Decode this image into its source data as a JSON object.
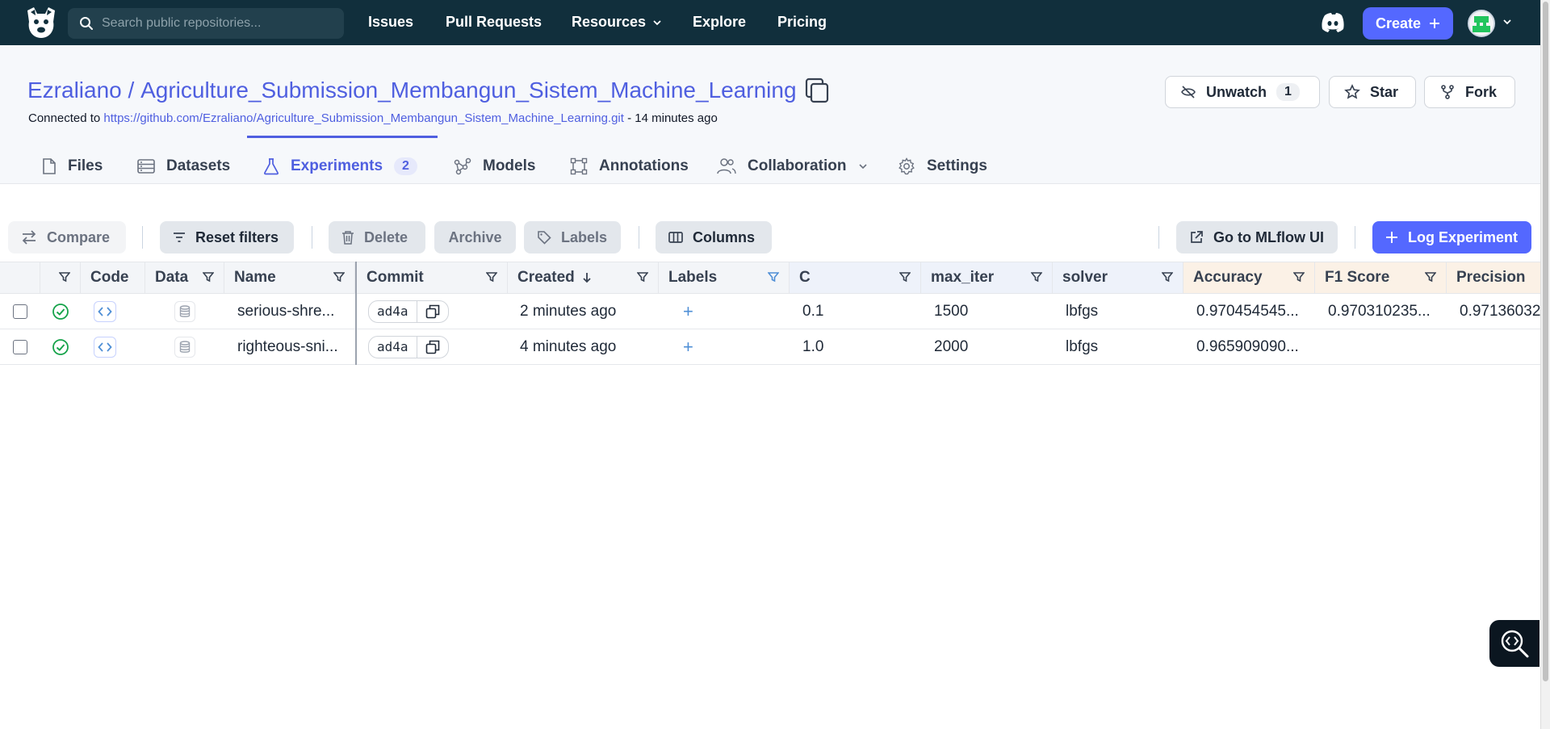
{
  "nav": {
    "search_placeholder": "Search public repositories...",
    "links": [
      "Issues",
      "Pull Requests",
      "Resources",
      "Explore",
      "Pricing"
    ],
    "create_label": "Create"
  },
  "repo": {
    "owner": "Ezraliano",
    "separator": " / ",
    "name": "Agriculture_Submission_Membangun_Sistem_Machine_Learning",
    "connected_prefix": "Connected to ",
    "connected_url": "https://github.com/Ezraliano/Agriculture_Submission_Membangun_Sistem_Machine_Learning.git",
    "connected_suffix": " - 14 minutes ago",
    "unwatch_label": "Unwatch",
    "unwatch_count": "1",
    "star_label": "Star",
    "fork_label": "Fork"
  },
  "tabs": {
    "files": "Files",
    "datasets": "Datasets",
    "experiments": "Experiments",
    "experiments_count": "2",
    "models": "Models",
    "annotations": "Annotations",
    "collaboration": "Collaboration",
    "settings": "Settings"
  },
  "toolbar": {
    "compare": "Compare",
    "reset_filters": "Reset filters",
    "delete": "Delete",
    "archive": "Archive",
    "labels": "Labels",
    "columns": "Columns",
    "mlflow": "Go to MLflow UI",
    "log_experiment": "Log Experiment"
  },
  "table": {
    "headers": {
      "code": "Code",
      "data": "Data",
      "name": "Name",
      "commit": "Commit",
      "created": "Created",
      "labels": "Labels",
      "c": "C",
      "max_iter": "max_iter",
      "solver": "solver",
      "accuracy": "Accuracy",
      "f1": "F1 Score",
      "precision": "Precision"
    },
    "rows": [
      {
        "name": "serious-shre...",
        "commit": "ad4a",
        "created": "2 minutes ago",
        "labels": "+",
        "c": "0.1",
        "max_iter": "1500",
        "solver": "lbfgs",
        "accuracy": "0.970454545...",
        "f1": "0.970310235...",
        "precision": "0.97136032"
      },
      {
        "name": "righteous-sni...",
        "commit": "ad4a",
        "created": "4 minutes ago",
        "labels": "+",
        "c": "1.0",
        "max_iter": "2000",
        "solver": "lbfgs",
        "accuracy": "0.965909090...",
        "f1": "",
        "precision": ""
      }
    ]
  },
  "colors": {
    "topbar": "#112f3c",
    "accent": "#5468ff",
    "link": "#4f5fe0",
    "success": "#16a34a"
  }
}
